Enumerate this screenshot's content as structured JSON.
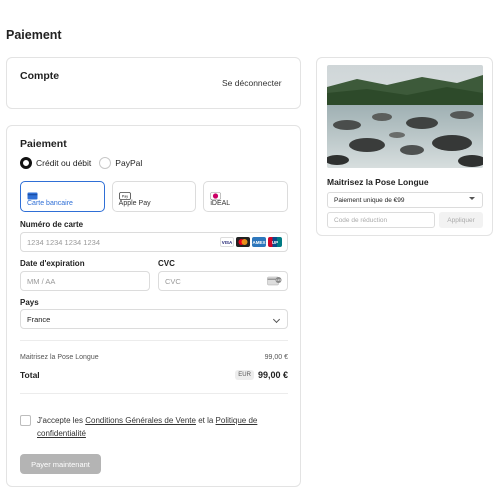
{
  "page": {
    "title": "Paiement"
  },
  "account": {
    "title": "Compte",
    "logout_label": "Se déconnecter"
  },
  "payment": {
    "title": "Paiement",
    "options": [
      {
        "label": "Crédit ou débit",
        "selected": true
      },
      {
        "label": "PayPal",
        "selected": false
      }
    ],
    "methods": [
      {
        "label": "Carte bancaire",
        "icon": "credit-card-icon",
        "active": true
      },
      {
        "label": "Apple Pay",
        "icon": "apple-pay-icon",
        "active": false
      },
      {
        "label": "iDEAL",
        "icon": "ideal-icon",
        "active": false
      }
    ],
    "card_number": {
      "label": "Numéro de carte",
      "placeholder": "1234 1234 1234 1234",
      "brands": [
        "VISA",
        "MC",
        "AMEX",
        "UP"
      ]
    },
    "expiry": {
      "label": "Date d'expiration",
      "placeholder": "MM / AA"
    },
    "cvc": {
      "label": "CVC",
      "placeholder": "CVC"
    },
    "country": {
      "label": "Pays",
      "value": "France"
    },
    "line_item": {
      "name": "Maitrisez la Pose Longue",
      "price": "99,00 €"
    },
    "total": {
      "label": "Total",
      "currency": "EUR",
      "value": "99,00 €"
    },
    "terms": {
      "prefix": "J'accepte les ",
      "cgv_link": "Conditions Générales de Vente",
      "middle": " et la ",
      "privacy_link": "Politique de confidentialité"
    },
    "pay_button": "Payer maintenant"
  },
  "product": {
    "name": "Maitrisez la Pose Longue",
    "plan": "Paiement unique de €99",
    "promo_placeholder": "Code de réduction",
    "apply_label": "Appliquer"
  },
  "colors": {
    "accent": "#2f6fd6",
    "disabled_button": "#b4b4b4"
  }
}
